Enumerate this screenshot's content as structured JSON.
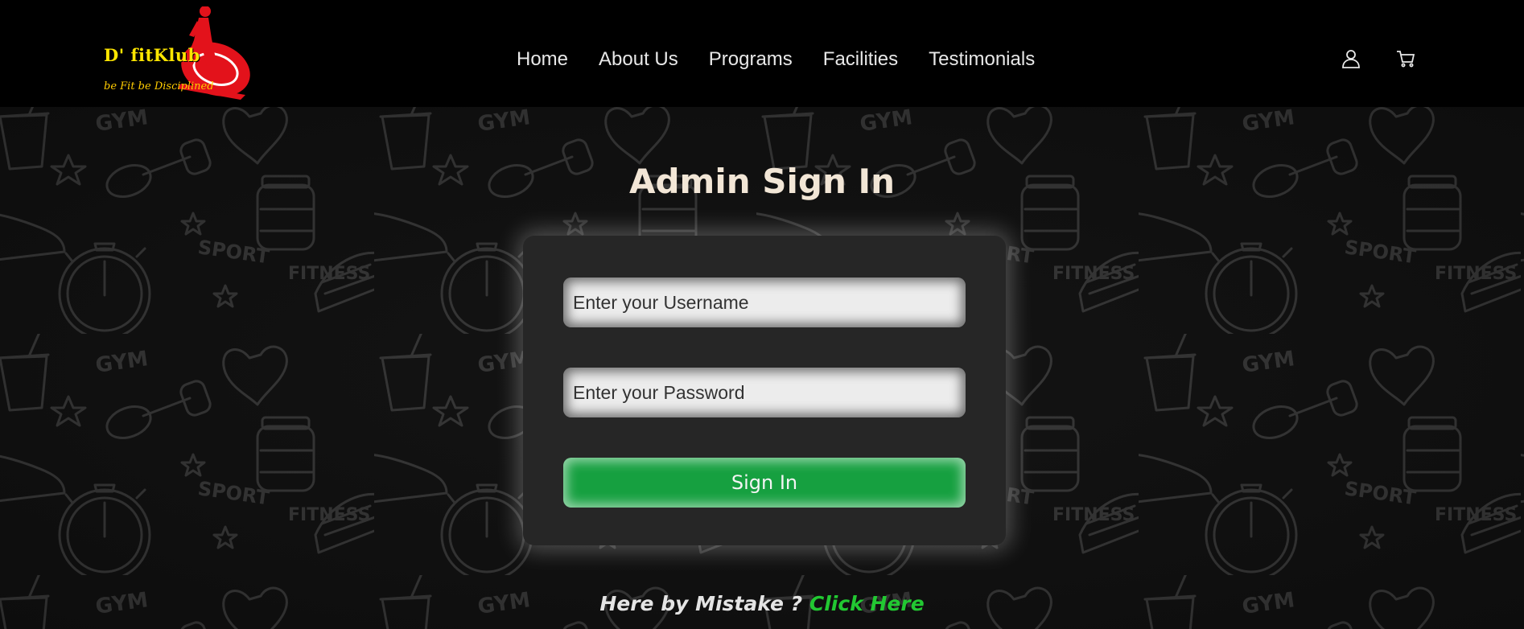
{
  "brand": {
    "name": "D' fitKlub",
    "tagline": "be Fit be Disciplined"
  },
  "nav": {
    "items": [
      {
        "label": "Home"
      },
      {
        "label": "About Us"
      },
      {
        "label": "Programs"
      },
      {
        "label": "Facilities"
      },
      {
        "label": "Testimonials"
      }
    ],
    "icons": [
      "user-icon",
      "cart-icon"
    ]
  },
  "background_words": [
    "GYM",
    "SPORT",
    "FITNESS"
  ],
  "form": {
    "title": "Admin Sign In",
    "username_placeholder": "Enter your Username",
    "password_placeholder": "Enter your Password",
    "submit_label": "Sign In"
  },
  "footer_prompt": {
    "text": "Here by Mistake ?",
    "link_label": "Click Here"
  },
  "colors": {
    "accent_green": "#16a040",
    "link_green": "#22c832",
    "logo_yellow": "#ffe600",
    "logo_red": "#e3121b",
    "title_cream": "#f2e6d6"
  }
}
